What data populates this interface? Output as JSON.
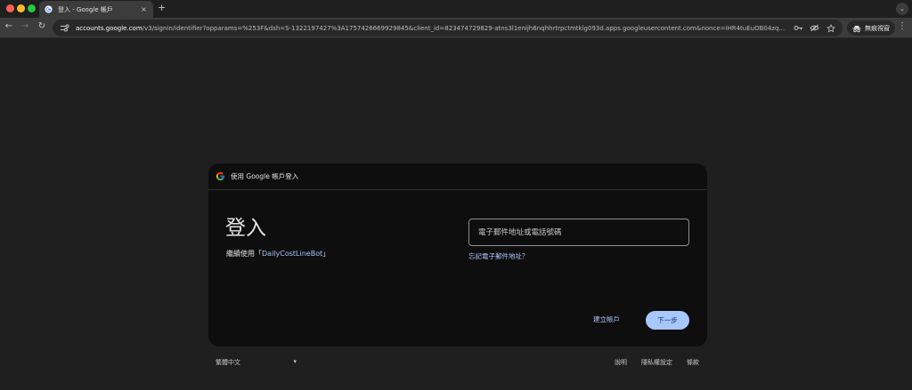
{
  "browser": {
    "tab": {
      "title": "登入 - Google 帳戶",
      "close_glyph": "×"
    },
    "new_tab_glyph": "+",
    "tab_menu_glyph": "⌄",
    "nav": {
      "back_glyph": "←",
      "forward_glyph": "→",
      "reload_glyph": "↻"
    },
    "address": {
      "host": "accounts.google.com",
      "path": "/v3/signin/identifier?opparams=%253F&dsh=S-1322197427%3A1757426669929845&client_id=823474729829-atns3l1enijh6nqhhrtrpctmtklg093d.apps.googleusercontent.com&nonce=iHR4tuEuOB04zq...",
      "icon_names": [
        "key-icon",
        "eye-off-icon",
        "star-icon"
      ]
    },
    "incognito_label": "無痕視窗",
    "more_glyph": "⋮"
  },
  "card": {
    "header": "使用 Google 帳戶登入",
    "title": "登入",
    "continue_prefix": "繼續使用「",
    "app_name": "DailyCostLineBot",
    "continue_suffix": "」",
    "email_placeholder": "電子郵件地址或電話號碼",
    "forgot_email": "忘記電子郵件地址？",
    "create_account": "建立帳戶",
    "next": "下一步"
  },
  "footer": {
    "language": "繁體中文",
    "language_arrow": "▾",
    "links": [
      "說明",
      "隱私權設定",
      "條款"
    ]
  },
  "colors": {
    "accent": "#a8c7fa",
    "button_text": "#062e6f",
    "card_bg": "#0e0e0e",
    "page_bg": "#1f1f1f"
  }
}
